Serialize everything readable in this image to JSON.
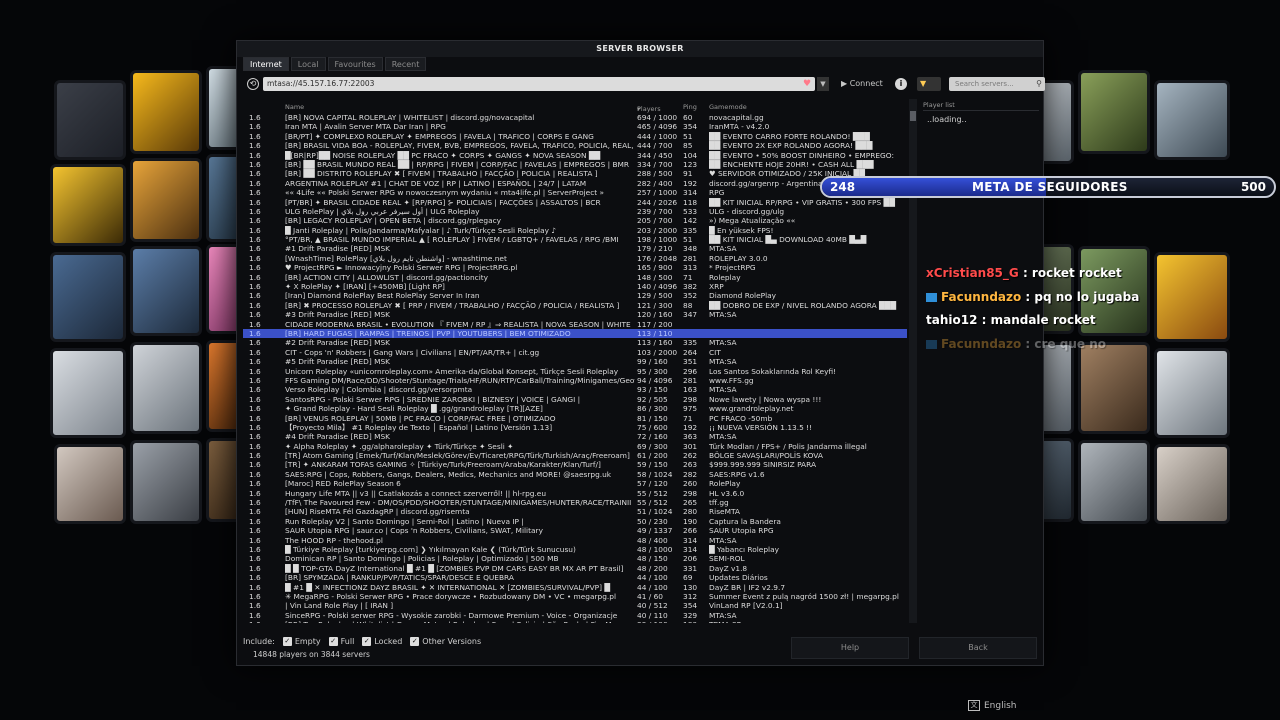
{
  "window": {
    "title": "SERVER BROWSER"
  },
  "tabs": [
    {
      "label": "Internet",
      "active": true
    },
    {
      "label": "Local",
      "active": false
    },
    {
      "label": "Favourites",
      "active": false
    },
    {
      "label": "Recent",
      "active": false
    }
  ],
  "toolbar": {
    "address": "mtasa://45.157.16.77:22003",
    "connect_label": "Connect",
    "search_placeholder": "Search servers..."
  },
  "columns": {
    "name": "Name",
    "players": "Players",
    "ping": "Ping",
    "gamemode": "Gamemode"
  },
  "servers": [
    {
      "ver": "1.6",
      "name": "[BR] NOVA CAPITAL ROLEPLAY | WHITELIST | discord.gg/novacapital",
      "players": "694 / 1000",
      "ping": "60",
      "mode": "novacapital.gg"
    },
    {
      "ver": "1.6",
      "name": "Iran MTA | Avalin Server MTA Dar Iran | RPG",
      "players": "465 / 4096",
      "ping": "354",
      "mode": "IranMTA - v4.2.0"
    },
    {
      "ver": "1.6",
      "name": "[BR/PT] ✦ COMPLEXO ROLEPLAY ✦ EMPREGOS | FAVELA | TRAFICO | CORPS E GANG",
      "players": "444 / 1000",
      "ping": "51",
      "mode": "██ EVENTO CARRO FORTE ROLANDO! ███"
    },
    {
      "ver": "1.6",
      "name": "[BR] BRASIL VIDA BOA - ROLEPLAY, FIVEM, BVB, EMPREGOS, FAVELA, TRAFICO, POLICIA, REAL, T",
      "players": "444 / 700",
      "ping": "85",
      "mode": "██ EVENTO 2X EXP ROLANDO AGORA! ███"
    },
    {
      "ver": "1.6",
      "name": "█[BR|RP]██ NOISE ROLEPLAY ██ PC FRACO ✦ CORPS ✦ GANGS ✦ NOVA SEASON ██",
      "players": "344 / 450",
      "ping": "104",
      "mode": "██ EVENTO • 50% BOOST DINHEIRO • EMPREGO:"
    },
    {
      "ver": "1.6",
      "name": "[BR] ██ BRASIL MUNDO REAL ██ | RP/RPG | FIVEM | CORP/FAC | FAVELAS | EMPREGOS | BMR",
      "players": "334 / 700",
      "ping": "123",
      "mode": "██ ENCHENTE HOJE 20HR! • CASH ALL ███"
    },
    {
      "ver": "1.6",
      "name": "[BR] ██ DISTRITO ROLEPLAY ✖ [ FIVEM | TRABALHO | FACÇÃO | POLICIA | REALISTA ]",
      "players": "288 / 500",
      "ping": "91",
      "mode": "♥ SERVIDOR OTIMIZADO / 25K INICIAL ██"
    },
    {
      "ver": "1.6",
      "name": "ARGENTINA ROLEPLAY #1 | CHAT DE VOZ | RP | LATINO | ESPAÑOL | 24/7 | LATAM",
      "players": "282 / 400",
      "ping": "192",
      "mode": "discord.gg/argenrp - Argentina"
    },
    {
      "ver": "1.6",
      "name": "«« 4Life «« Polski Serwer RPG w nowoczesnym wydaniu « mta4life.pl | ServerProject »",
      "players": "257 / 1000",
      "ping": "314",
      "mode": "RPG"
    },
    {
      "ver": "1.6",
      "name": "[PT/BR] ✦ BRASIL CIDADE REAL ✦ [RP/RPG] ⊱ POLICIAIS | FACÇÕES | ASSALTOS | BCR",
      "players": "244 / 2026",
      "ping": "118",
      "mode": "██ KIT INICIAL RP/RPG • VIP GRATIS • 300 FPS ██"
    },
    {
      "ver": "1.6",
      "name": "ULG RolePlay | أول سيرفر عربي رول بلاي | ULG Roleplay",
      "players": "239 / 700",
      "ping": "533",
      "mode": "ULG - discord.gg/ulg"
    },
    {
      "ver": "1.6",
      "name": "[BR] LEGACY ROLEPLAY | OPEN BETA | discord.gg/rplegacy",
      "players": "205 / 700",
      "ping": "142",
      "mode": "») Mega Atualização ««"
    },
    {
      "ver": "1.6",
      "name": "█ Janti Roleplay | Polis/Jandarma/Mafyalar | ♪ Turk/Türkçe Sesli Roleplay ♪",
      "players": "203 / 2000",
      "ping": "335",
      "mode": "█ En yüksek FPS!"
    },
    {
      "ver": "1.6",
      "name": "°PT/BR, ▲ BRASIL MUNDO IMPERIAL ▲ [ ROLEPLAY ] FIVEM / LGBTQ+ / FAVELAS / RPG /BMI",
      "players": "198 / 1000",
      "ping": "51",
      "mode": "██ KIT INICIAL █▄ DOWNLOAD 40MB █▄█"
    },
    {
      "ver": "1.6",
      "name": "#1 Drift Paradise [RED] MSK",
      "players": "179 / 210",
      "ping": "348",
      "mode": "MTA:SA"
    },
    {
      "ver": "1.6",
      "name": "[WnashTime] RolePlay [واشنطن تايم رول بلاي] - wnashtime.net",
      "players": "176 / 2048",
      "ping": "281",
      "mode": "ROLEPLAY 3.0.0"
    },
    {
      "ver": "1.6",
      "name": "♥ ProjectRPG ► Innowacyjny Polski Serwer RPG | ProjectRPG.pl",
      "players": "165 / 900",
      "ping": "313",
      "mode": "* ProjectRPG"
    },
    {
      "ver": "1.6",
      "name": "[BR] ACTION CITY | ALLOWLIST | discord.gg/pactioncity",
      "players": "148 / 500",
      "ping": "71",
      "mode": "Roleplay"
    },
    {
      "ver": "1.6",
      "name": "✦ X RolePlay ✦ [IRAN] [+450MB] [Light RP]",
      "players": "140 / 4096",
      "ping": "382",
      "mode": "XRP"
    },
    {
      "ver": "1.6",
      "name": "[Iran] Diamond RolePlay Best RolePlay Server In Iran",
      "players": "129 / 500",
      "ping": "352",
      "mode": "Diamond RolePlay"
    },
    {
      "ver": "1.6",
      "name": "[BR] ✖ PROCESSO ROLEPLAY ✖ [ PRP / FIVEM / TRABALHO / FACÇÃO / POLICIA / REALISTA ]",
      "players": "121 / 300",
      "ping": "88",
      "mode": "██ DOBRO DE EXP / NIVEL ROLANDO AGORA ███"
    },
    {
      "ver": "1.6",
      "name": "#3 Drift Paradise [RED] MSK",
      "players": "120 / 160",
      "ping": "347",
      "mode": "MTA:SA"
    },
    {
      "ver": "1.6",
      "name": "CIDADE MODERNA BRASIL • EVOLUTION 『 FIVEM / RP 』⇒ REALISTA | NOVA SEASON | WHITE",
      "players": "117 / 200",
      "ping": "",
      "mode": ""
    },
    {
      "ver": "1.6",
      "name": "[BR] HARD FUGAS | RAMPAS | TREINOS | PVP | YOUTUBERS | BEM OTIMIZADO",
      "players": "113 / 110",
      "ping": "",
      "mode": "",
      "selected": true
    },
    {
      "ver": "1.6",
      "name": "#2 Drift Paradise [RED] MSK",
      "players": "113 / 160",
      "ping": "335",
      "mode": "MTA:SA"
    },
    {
      "ver": "1.6",
      "name": "CIT - Cops 'n' Robbers | Gang Wars | Civilians | EN/PT/AR/TR+ | cit.gg",
      "players": "103 / 2000",
      "ping": "264",
      "mode": "CIT"
    },
    {
      "ver": "1.6",
      "name": "#5 Drift Paradise [RED] MSK",
      "players": "99 / 160",
      "ping": "351",
      "mode": "MTA:SA"
    },
    {
      "ver": "1.6",
      "name": "Unicorn Roleplay «unicornroleplay.com» Amerika-da/Global Konsept, Türkçe Sesli Roleplay",
      "players": "95 / 300",
      "ping": "296",
      "mode": "Los Santos Sokaklarında Rol Keyfi!"
    },
    {
      "ver": "1.6",
      "name": "FFS Gaming DM/Race/DD/Shooter/Stuntage/Trials/HF/RUN/RTP/CarBall/Training/Minigames/Geot",
      "players": "94 / 4096",
      "ping": "281",
      "mode": "www.FFS.gg"
    },
    {
      "ver": "1.6",
      "name": "Verso Roleplay | Colombia | discord.gg/versorpmta",
      "players": "93 / 150",
      "ping": "163",
      "mode": "MTA:SA"
    },
    {
      "ver": "1.6",
      "name": "SantosRPG - Polski Serwer RPG | SREDNIE ZAROBKI | BIZNESY | VOICE | GANGI |",
      "players": "92 / 505",
      "ping": "298",
      "mode": "Nowe lawety | Nowa wyspa !!!"
    },
    {
      "ver": "1.6",
      "name": "✦ Grand Roleplay - Hard Sesli Roleplay █ .gg/grandroleplay [TR][AZE]",
      "players": "86 / 300",
      "ping": "975",
      "mode": "www.grandroleplay.net"
    },
    {
      "ver": "1.6",
      "name": "[BR] VENUS ROLEPLAY | 50MB | PC FRACO | CORP/FAC FREE | OTIMIZADO",
      "players": "81 / 150",
      "ping": "71",
      "mode": "PC FRACO -50mb"
    },
    {
      "ver": "1.6",
      "name": "【Proyecto Mila】 #1 Roleplay de Texto │ Español | Latino [Versión 1.13]",
      "players": "75 / 600",
      "ping": "192",
      "mode": "¡¡ NUEVA VERSIÓN 1.13.5 !!"
    },
    {
      "ver": "1.6",
      "name": "#4 Drift Paradise [RED] MSK",
      "players": "72 / 160",
      "ping": "363",
      "mode": "MTA:SA"
    },
    {
      "ver": "1.6",
      "name": "✦ Alpha Roleplay ✦ .gg/alpharoleplay ✦ Türk/Türkçe ✦ Sesli ✦",
      "players": "69 / 300",
      "ping": "301",
      "mode": "Türk Modları / FPS+ / Polis Jandarma İllegal"
    },
    {
      "ver": "1.6",
      "name": "[TR] Atom Gaming [Emek/Turf/Klan/Meslek/Görev/Ev/Ticaret/RPG/Türk/Turkish/Araç/Freeroam]",
      "players": "61 / 200",
      "ping": "262",
      "mode": "BÖLGE SAVAŞLARI/POLİS KOVA"
    },
    {
      "ver": "1.6",
      "name": "[TR] ✦ ANKARAM TOFAS GAMING ✧ [Türkiye/Turk/Freeroam/Araba/Karakter/Klan/Turf/]",
      "players": "59 / 150",
      "ping": "263",
      "mode": "$999.999.999 SINIRSIZ PARA"
    },
    {
      "ver": "1.6",
      "name": "SAES:RPG | Cops, Robbers, Gangs, Dealers, Medics, Mechanics and MORE! @saesrpg.uk",
      "players": "58 / 1024",
      "ping": "282",
      "mode": "SAES:RPG v1.6"
    },
    {
      "ver": "1.6",
      "name": "[Maroc] RED RolePlay Season 6",
      "players": "57 / 120",
      "ping": "260",
      "mode": "RolePlay"
    },
    {
      "ver": "1.6",
      "name": "Hungary Life MTA || v3 || Csatlakozás a connect szerverről! || hl-rpg.eu",
      "players": "55 / 512",
      "ping": "298",
      "mode": "HL v3.6.0"
    },
    {
      "ver": "1.6",
      "name": "/TfF\\ The Favoured Few - DM/OS/PDD/SHOOTER/STUNTAGE/MINIGAMES/HUNTER/RACE/TRAINII",
      "players": "55 / 512",
      "ping": "265",
      "mode": "tff.gg"
    },
    {
      "ver": "1.6",
      "name": "[HUN] RiseMTA Fél GazdagRP | discord.gg/risemta",
      "players": "51 / 1024",
      "ping": "280",
      "mode": "RiseMTA"
    },
    {
      "ver": "1.6",
      "name": "Run Roleplay V2 | Santo Domingo | Semi-Rol | Latino | Nueva IP |",
      "players": "50 / 230",
      "ping": "190",
      "mode": "Captura la Bandera"
    },
    {
      "ver": "1.6",
      "name": "SAUR Utopia RPG | saur.co | Cops 'n Robbers, Civilians, SWAT, Military",
      "players": "49 / 1337",
      "ping": "266",
      "mode": "SAUR Utopia RPG"
    },
    {
      "ver": "1.6",
      "name": "The HOOD RP - thehood.pl",
      "players": "48 / 400",
      "ping": "314",
      "mode": "MTA:SA"
    },
    {
      "ver": "1.6",
      "name": "█ Türkiye Roleplay [turkiyerpg.com] ❯ Yıkılmayan Kale ❮ (Türk/Türk Sunucusu)",
      "players": "48 / 1000",
      "ping": "314",
      "mode": "█ Yabancı Roleplay"
    },
    {
      "ver": "1.6",
      "name": "Dominican RP | Santo Domingo | Policias | Roleplay | Optimizado | 500 MB",
      "players": "48 / 150",
      "ping": "206",
      "mode": "SEMI-ROL"
    },
    {
      "ver": "1.6",
      "name": "█ █ TOP-GTA DayZ International █ #1 █ [ZOMBIES PVP DM CARS EASY BR MX AR PT Brasil]",
      "players": "48 / 200",
      "ping": "331",
      "mode": "DayZ v1.8"
    },
    {
      "ver": "1.6",
      "name": "[BR] SPYMZADA | RANKUP/PVP/TATICS/SPAR/DESCE E QUEBRA",
      "players": "44 / 100",
      "ping": "69",
      "mode": "Updates Diários"
    },
    {
      "ver": "1.6",
      "name": "█ #1 █ ✕ INFECTIONZ DAYZ BRASIL ✦ ✕ INTERNATIONAL ✕ [ZOMBIES/SURVIVAL/PVP] █",
      "players": "44 / 100",
      "ping": "130",
      "mode": "DayZ BR | IF2 v2.9.7"
    },
    {
      "ver": "1.6",
      "name": "✳ MegaRPG - Polski Serwer RPG • Prace dorywcze • Rozbudowany DM • VC • megarpg.pl",
      "players": "41 / 60",
      "ping": "312",
      "mode": "Summer Event z pulą nagród 1500 zł! | megarpg.pl"
    },
    {
      "ver": "1.6",
      "name": "| Vin Land Role Play | [ IRAN ]",
      "players": "40 / 512",
      "ping": "354",
      "mode": "VinLand RP [V2.0.1]"
    },
    {
      "ver": "1.6",
      "name": "SinceRPG - Polski serwer RPG - Wysokie zarobki - Darmowe Premium - Voice - Organizacje",
      "players": "40 / 110",
      "ping": "329",
      "mode": "MTA:SA"
    },
    {
      "ver": "1.6",
      "name": "[BR] Top Roleplay | Whitelist | Grau e Motos | Roleplay | Fuga | Policia | São Paulo | FiveM",
      "players": "39 / 100",
      "ping": "180",
      "mode": "TEMA SP"
    }
  ],
  "playerlist": {
    "header": "Player list",
    "status": "..loading.."
  },
  "footer": {
    "include_label": "Include:",
    "filters": [
      "Empty",
      "Full",
      "Locked",
      "Other Versions"
    ],
    "count_text": "14848 players on 3844 servers",
    "help_label": "Help",
    "back_label": "Back"
  },
  "overlay": {
    "goal_current": "248",
    "goal_title": "META DE SEGUIDORES",
    "goal_target": "500",
    "goal_progress": 0.496,
    "chat": [
      {
        "user": "xCristian85_G",
        "text": ": rocket rocket",
        "color": "#ff4b4b",
        "badge": false
      },
      {
        "user": "Facunndazo",
        "text": ": pq no lo jugaba",
        "color": "#ffb640",
        "badge": true
      },
      {
        "user": "tahio12",
        "text": ": mandale rocket",
        "color": "#ffffff",
        "badge": false
      },
      {
        "user": "Facunndazo",
        "text": ": cre que no",
        "color": "#ffb640",
        "badge": true,
        "fade": true
      }
    ]
  },
  "language": "English",
  "colors": {
    "selection": "#3b51c8",
    "accent": "#3550d8"
  }
}
